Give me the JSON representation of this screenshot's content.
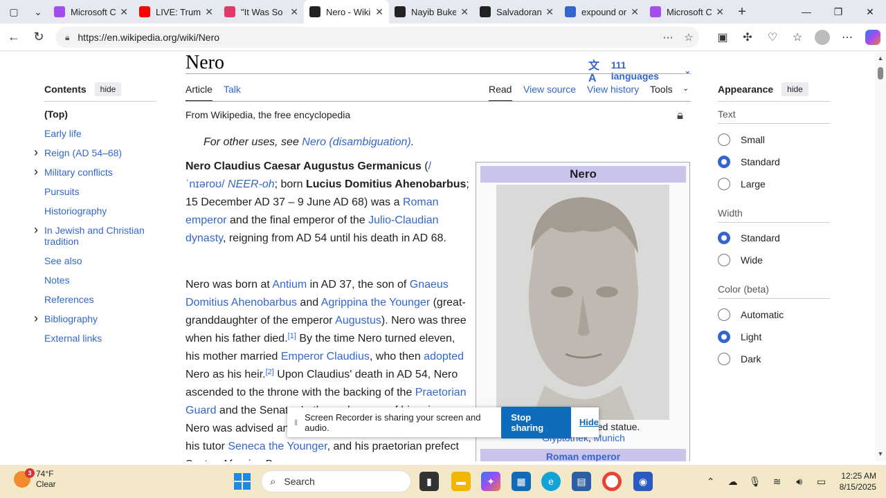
{
  "browser": {
    "tabs": [
      {
        "title": "Microsoft C",
        "favicon": "copilot-icon",
        "color": "#a34cf0"
      },
      {
        "title": "LIVE: Trump",
        "favicon": "youtube-icon",
        "color": "#ff0000"
      },
      {
        "title": "\"It Was So C",
        "favicon": "youtube-icon",
        "color": "#e6396b"
      },
      {
        "title": "Nero - Wiki",
        "favicon": "wikipedia-icon",
        "color": "#222222",
        "active": true
      },
      {
        "title": "Nayib Buke",
        "favicon": "wikipedia-icon",
        "color": "#222222"
      },
      {
        "title": "Salvadoran",
        "favicon": "wikipedia-icon",
        "color": "#222222"
      },
      {
        "title": "expound or",
        "favicon": "search-icon",
        "color": "#3366cc"
      },
      {
        "title": "Microsoft C",
        "favicon": "copilot-icon",
        "color": "#a34cf0"
      }
    ],
    "url": "https://en.wikipedia.org/wiki/Nero"
  },
  "article": {
    "title": "Nero",
    "languages": "111 languages",
    "tabs": {
      "article": "Article",
      "talk": "Talk",
      "read": "Read",
      "view_source": "View source",
      "view_history": "View history",
      "tools": "Tools"
    },
    "from": "From Wikipedia, the free encyclopedia",
    "hatnote_prefix": "For other uses, see ",
    "hatnote_link": "Nero (disambiguation)",
    "hatnote_suffix": "."
  },
  "toc": {
    "heading": "Contents",
    "hide": "hide",
    "items": [
      {
        "label": "(Top)",
        "expandable": false
      },
      {
        "label": "Early life",
        "expandable": false
      },
      {
        "label": "Reign (AD 54–68)",
        "expandable": true
      },
      {
        "label": "Military conflicts",
        "expandable": true
      },
      {
        "label": "Pursuits",
        "expandable": false
      },
      {
        "label": "Historiography",
        "expandable": false
      },
      {
        "label": "In Jewish and Christian tradition",
        "expandable": true
      },
      {
        "label": "See also",
        "expandable": false
      },
      {
        "label": "Notes",
        "expandable": false
      },
      {
        "label": "References",
        "expandable": false
      },
      {
        "label": "Bibliography",
        "expandable": true
      },
      {
        "label": "External links",
        "expandable": false
      }
    ]
  },
  "infobox": {
    "title": "Nero",
    "caption_visible": "versized statue.",
    "caption_links": [
      "Glyptothek",
      "Munich"
    ],
    "subheader": "Roman emperor"
  },
  "appearance": {
    "heading": "Appearance",
    "hide": "hide",
    "text_label": "Text",
    "text_options": [
      {
        "label": "Small",
        "selected": false
      },
      {
        "label": "Standard",
        "selected": true
      },
      {
        "label": "Large",
        "selected": false
      }
    ],
    "width_label": "Width",
    "width_options": [
      {
        "label": "Standard",
        "selected": true
      },
      {
        "label": "Wide",
        "selected": false
      }
    ],
    "color_label": "Color (beta)",
    "color_options": [
      {
        "label": "Automatic",
        "selected": false
      },
      {
        "label": "Light",
        "selected": true
      },
      {
        "label": "Dark",
        "selected": false
      }
    ]
  },
  "sharebar": {
    "message": "Screen Recorder is sharing your screen and audio.",
    "stop": "Stop sharing",
    "hide": "Hide"
  },
  "taskbar": {
    "weather_temp": "74°F",
    "weather_cond": "Clear",
    "weather_badge": "3",
    "search": "Search",
    "time": "12:25 AM",
    "date": "8/15/2025"
  }
}
